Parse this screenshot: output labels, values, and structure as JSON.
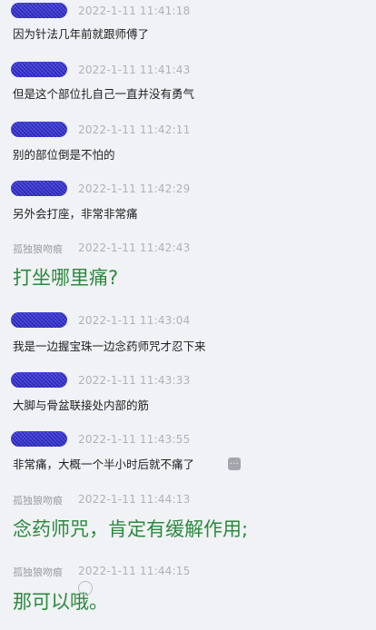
{
  "messages": [
    {
      "sender": "",
      "time": "2022-1-11 11:41:18",
      "text": "因为针法几年前就跟师傅了",
      "big": false
    },
    {
      "sender": "",
      "time": "2022-1-11 11:41:43",
      "text": "但是这个部位扎自己一直并没有勇气",
      "big": false
    },
    {
      "sender": "",
      "time": "2022-1-11 11:42:11",
      "text": "别的部位倒是不怕的",
      "big": false
    },
    {
      "sender": "",
      "time": "2022-1-11 11:42:29",
      "text": "另外会打座，非常非常痛",
      "big": false
    },
    {
      "sender": "孤独狼吻痕",
      "time": "2022-1-11 11:42:43",
      "text": "打坐哪里痛?",
      "big": true
    },
    {
      "sender": "",
      "time": "2022-1-11 11:43:04",
      "text": "我是一边握宝珠一边念药师咒才忍下来",
      "big": false
    },
    {
      "sender": "",
      "time": "2022-1-11 11:43:33",
      "text": "大脚与骨盆联接处内部的筋",
      "big": false
    },
    {
      "sender": "",
      "time": "2022-1-11 11:43:55",
      "text": "非常痛，大概一个半小时后就不痛了",
      "big": false,
      "more": "..."
    },
    {
      "sender": "孤独狼吻痕",
      "time": "2022-1-11 11:44:13",
      "text": "念药师咒，肯定有缓解作用;",
      "big": true
    },
    {
      "sender": "孤独狼吻痕",
      "time": "2022-1-11 11:44:15",
      "text": "那可以哦。",
      "big": true
    }
  ]
}
